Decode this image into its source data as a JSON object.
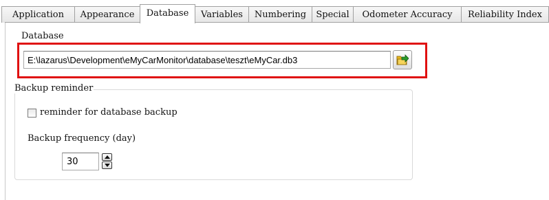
{
  "tabs": [
    {
      "label": "Application",
      "active": false
    },
    {
      "label": "Appearance",
      "active": false
    },
    {
      "label": "Database",
      "active": true
    },
    {
      "label": "Variables",
      "active": false
    },
    {
      "label": "Numbering",
      "active": false
    },
    {
      "label": "Special",
      "active": false
    },
    {
      "label": "Odometer Accuracy",
      "active": false
    },
    {
      "label": "Reliability Index",
      "active": false
    }
  ],
  "database_group": {
    "caption": "Database",
    "path_value": "E:\\lazarus\\Development\\eMyCarMonitor\\database\\teszt\\eMyCar.db3",
    "browse_icon": "folder-open-icon"
  },
  "backup_group": {
    "caption": "Backup reminder",
    "reminder_label": "reminder for database backup",
    "reminder_checked": false,
    "frequency_label": "Backup frequency (day)",
    "frequency_value": "30"
  },
  "colors": {
    "highlight": "#e01010",
    "folder_icon_yellow": "#e8b820",
    "folder_icon_arrow": "#2a9a2a"
  }
}
